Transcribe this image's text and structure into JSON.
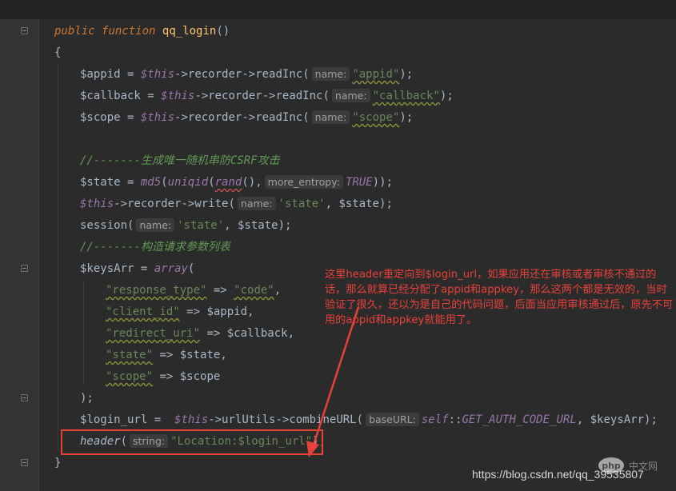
{
  "colors": {
    "annotation": "#e8413a",
    "background": "#2b2b2b"
  },
  "code": {
    "l1": [
      "public",
      "function",
      "qq_login",
      "()"
    ],
    "l2": "{",
    "l3": {
      "var": "$appid",
      "eq": " = ",
      "this": "$this",
      "a1": "->",
      "m1": "recorder",
      "a2": "->",
      "m2": "readInc",
      "p1": "(",
      "hint": "name:",
      "str": "\"appid\"",
      "end": ");"
    },
    "l4": {
      "var": "$callback",
      "eq": " = ",
      "this": "$this",
      "a1": "->",
      "m1": "recorder",
      "a2": "->",
      "m2": "readInc",
      "p1": "(",
      "hint": "name:",
      "str": "\"callback\"",
      "end": ");"
    },
    "l5": {
      "var": "$scope",
      "eq": " = ",
      "this": "$this",
      "a1": "->",
      "m1": "recorder",
      "a2": "->",
      "m2": "readInc",
      "p1": "(",
      "hint": "name:",
      "str": "\"scope\"",
      "end": ");"
    },
    "l6": "//-------生成唯一随机串防CSRF攻击",
    "l7": {
      "var": "$state",
      "eq": " = ",
      "f1": "md5",
      "p1": "(",
      "f2": "uniqid",
      "p2": "(",
      "f3": "rand",
      "p3": "()",
      "comma": ",",
      "hint": "more_entropy:",
      "tru": "TRUE",
      "end": "));"
    },
    "l8": {
      "this": "$this",
      "a1": "->",
      "m1": "recorder",
      "a2": "->",
      "m2": "write",
      "p1": "(",
      "hint": "name:",
      "str": "'state'",
      "rest": ", $state);"
    },
    "l9": {
      "f": "session",
      "p1": "(",
      "hint": "name:",
      "str": "'state'",
      "rest": ", $state);"
    },
    "l10": "//-------构造请求参数列表",
    "l11": {
      "var": "$keysArr",
      "eq": " = ",
      "f": "array",
      "p": "("
    },
    "l12": {
      "key": "\"response_type\"",
      "arrow": " => ",
      "val": "\"code\"",
      "c": ","
    },
    "l13": {
      "key": "\"client_id\"",
      "arrow": " => ",
      "val": "$appid",
      "c": ","
    },
    "l14": {
      "key": "\"redirect_uri\"",
      "arrow": " => ",
      "val": "$callback",
      "c": ","
    },
    "l15": {
      "key": "\"state\"",
      "arrow": " => ",
      "val": "$state",
      "c": ","
    },
    "l16": {
      "key": "\"scope\"",
      "arrow": " => ",
      "val": "$scope"
    },
    "l17": ");",
    "l18": {
      "var": "$login_url",
      "eq": " =  ",
      "this": "$this",
      "a1": "->",
      "m1": "urlUtils",
      "a2": "->",
      "m2": "combineURL",
      "p1": "(",
      "hint": "baseURL:",
      "self": "self",
      "cc": "::",
      "const": "GET_AUTH_CODE_URL",
      "rest": ", $keysArr);"
    },
    "l19": {
      "f": "header",
      "p1": "(",
      "hint": "string:",
      "str": "\"Location:$login_url\"",
      "end": ");"
    },
    "l20": "}"
  },
  "annotation": "这里header重定向到$login_url，如果应用还在审核或者审核不通过的话，那么就算已经分配了appid和appkey，那么这两个都是无效的，当时验证了很久，还以为是自己的代码问题，后面当应用审核通过后，原先不可用的appid和appkey就能用了。",
  "watermark": "https://blog.csdn.net/qq_39535807",
  "php_logo": "php",
  "cn_logo": "中文网"
}
